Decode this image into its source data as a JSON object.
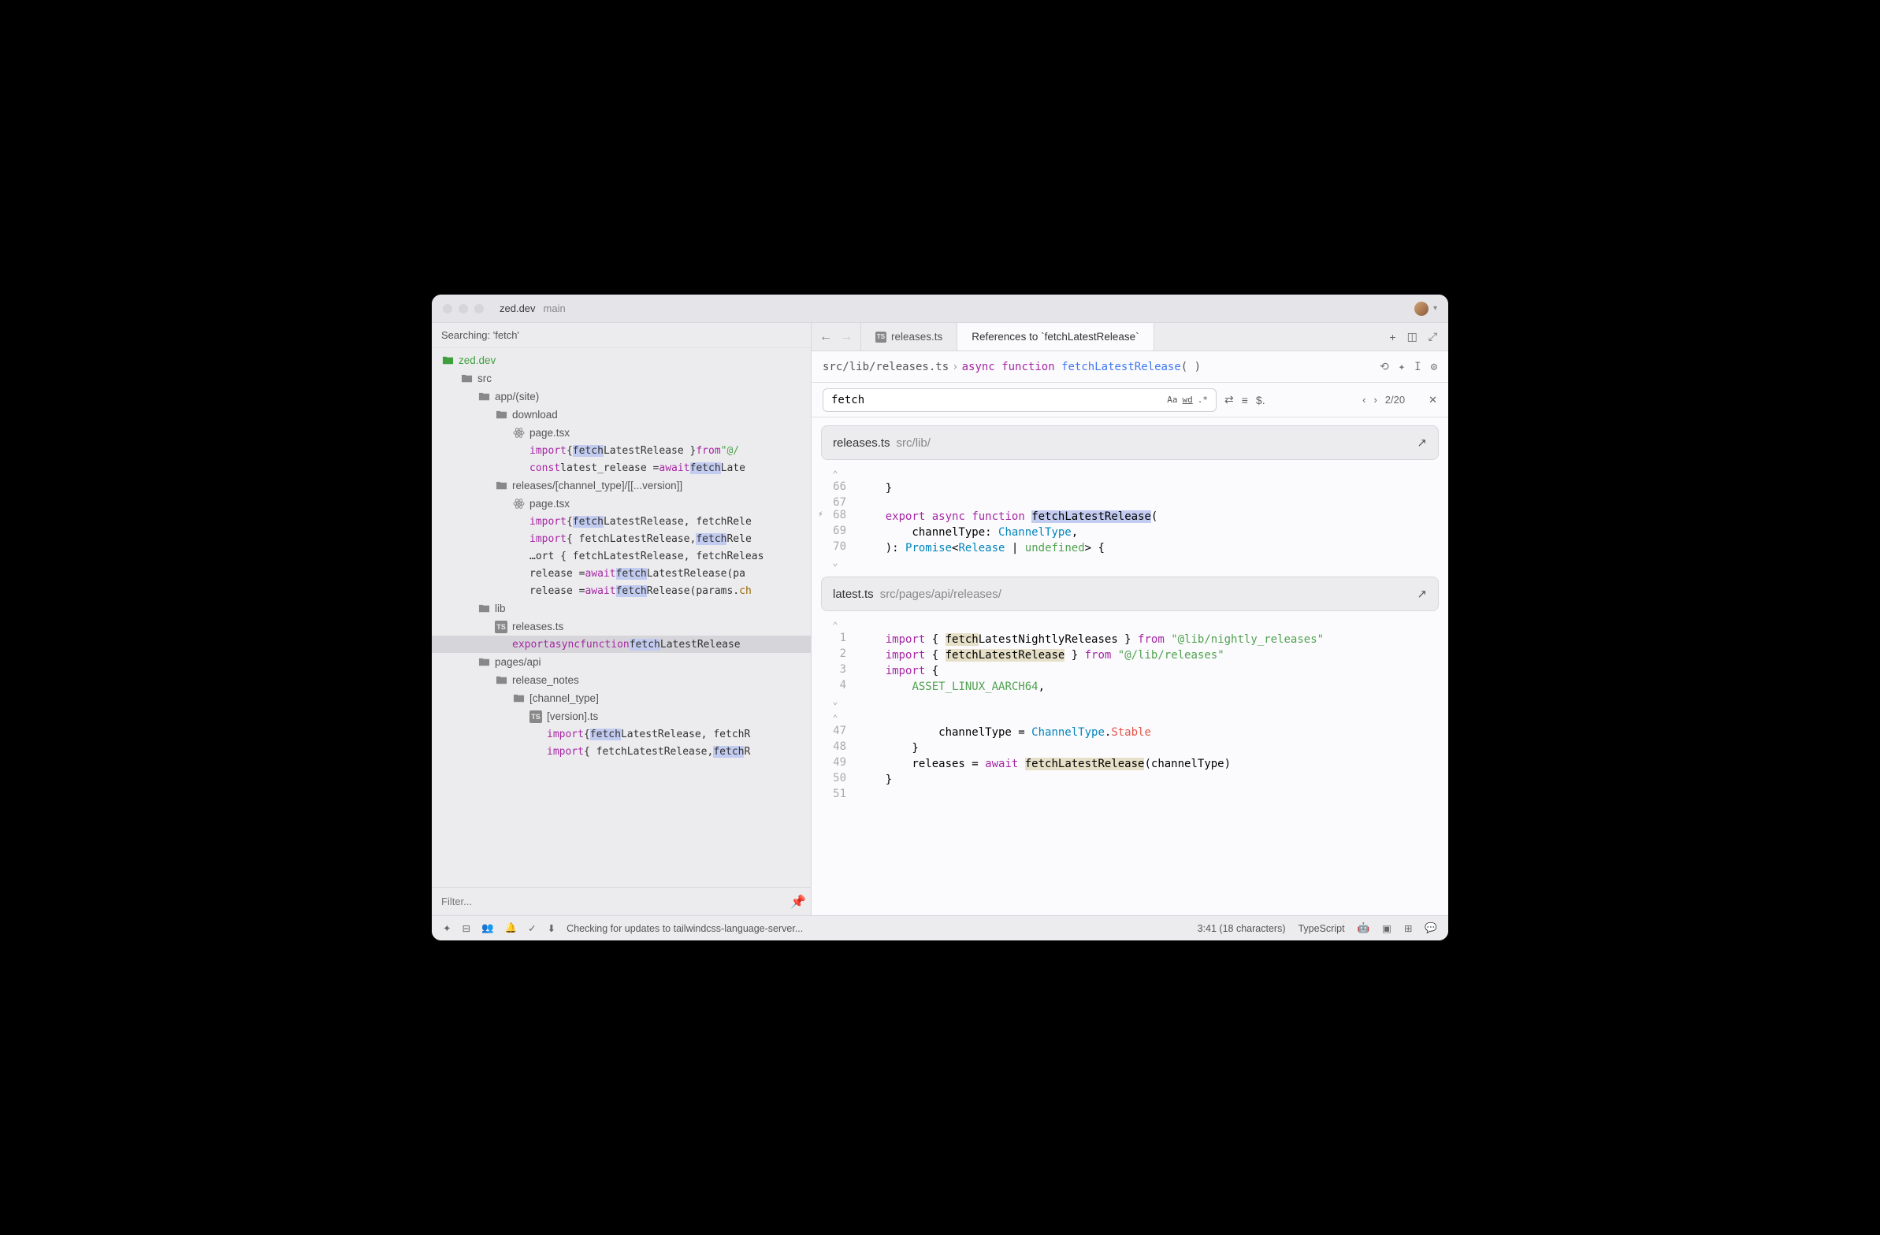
{
  "title": {
    "project": "zed.dev",
    "branch": "main"
  },
  "sidebar": {
    "search_label": "Searching: 'fetch'",
    "filter_placeholder": "Filter...",
    "tree": {
      "root": "zed.dev",
      "src": "src",
      "app_site": "app/(site)",
      "download": "download",
      "page_tsx_1": "page.tsx",
      "releases_channel": "releases/[channel_type]/[[...version]]",
      "page_tsx_2": "page.tsx",
      "lib": "lib",
      "releases_ts": "releases.ts",
      "pages_api": "pages/api",
      "release_notes": "release_notes",
      "channel_type": "[channel_type]",
      "version_ts": "[version].ts"
    },
    "snippets": {
      "s1_a": "import",
      "s1_b": " { ",
      "s1_c": "fetch",
      "s1_d": "LatestRelease } ",
      "s1_e": "from",
      "s1_f": " \"@/",
      "s2_a": "const",
      "s2_b": " latest_release = ",
      "s2_c": "await",
      "s2_d": " ",
      "s2_e": "fetch",
      "s2_f": "Late",
      "s3_a": "import",
      "s3_b": " { ",
      "s3_c": "fetch",
      "s3_d": "LatestRelease, fetchRele",
      "s4_a": "import",
      "s4_b": " { fetchLatestRelease, ",
      "s4_c": "fetch",
      "s4_d": "Rele",
      "s5_a": "…ort { fetchLatestRelease, fetchReleas",
      "s6_a": "release = ",
      "s6_b": "await",
      "s6_c": " ",
      "s6_d": "fetch",
      "s6_e": "LatestRelease(pa",
      "s7_a": "release = ",
      "s7_b": "await",
      "s7_c": " ",
      "s7_d": "fetch",
      "s7_e": "Release(params.",
      "s7_f": "ch",
      "s8_a": "export",
      "s8_b": " ",
      "s8_c": "async",
      "s8_d": " ",
      "s8_e": "function",
      "s8_f": " ",
      "s8_g": "fetch",
      "s8_h": "LatestRelease",
      "s9_a": "import",
      "s9_b": " { ",
      "s9_c": "fetch",
      "s9_d": "LatestRelease, fetchR",
      "s10_a": "import",
      "s10_b": " { fetchLatestRelease, ",
      "s10_c": "fetch",
      "s10_d": "R"
    }
  },
  "editor": {
    "tabs": {
      "releases": "releases.ts",
      "references": "References to `fetchLatestRelease`"
    },
    "breadcrumb": {
      "path": "src/lib/releases.ts",
      "kw_async": "async",
      "kw_function": "function",
      "fn": "fetchLatestRelease",
      "parens": "( )"
    },
    "search": {
      "value": "fetch",
      "case": "Aa",
      "word": "wd",
      "regex": ".*",
      "count": "2/20"
    },
    "result1": {
      "fname": "releases.ts",
      "fpath": "src/lib/"
    },
    "result2": {
      "fname": "latest.ts",
      "fpath": "src/pages/api/releases/"
    },
    "lines": {
      "l66_num": "66",
      "l66": "    }",
      "l67_num": "67",
      "l67": "",
      "l68_num": "68",
      "l68_a": "export",
      "l68_b": "async",
      "l68_c": "function",
      "l68_d": "fetchLatestRelease",
      "l68_e": "(",
      "l69_num": "69",
      "l69_a": "        channelType: ",
      "l69_b": "ChannelType",
      "l69_c": ",",
      "l70_num": "70",
      "l70_a": "    ): ",
      "l70_b": "Promise",
      "l70_c": "<",
      "l70_d": "Release",
      "l70_e": " | ",
      "l70_f": "undefined",
      "l70_g": "> {",
      "b1_num": "1",
      "b1_a": "import",
      "b1_b": " { ",
      "b1_c": "fetch",
      "b1_d": "LatestNightlyReleases } ",
      "b1_e": "from",
      "b1_f": " ",
      "b1_g": "\"@lib/nightly_releases\"",
      "b2_num": "2",
      "b2_a": "import",
      "b2_b": " { ",
      "b2_c": "fetchLatestRelease",
      "b2_d": " } ",
      "b2_e": "from",
      "b2_f": " ",
      "b2_g": "\"@/lib/releases\"",
      "b3_num": "3",
      "b3_a": "import",
      "b3_b": " {",
      "b4_num": "4",
      "b4_a": "        ",
      "b4_b": "ASSET_LINUX_AARCH64",
      "b4_c": ",",
      "c47_num": "47",
      "c47_a": "            channelType = ",
      "c47_b": "ChannelType",
      "c47_c": ".",
      "c47_d": "Stable",
      "c48_num": "48",
      "c48": "        }",
      "c49_num": "49",
      "c49_a": "        releases = ",
      "c49_b": "await",
      "c49_c": " ",
      "c49_d": "fetchLatestRelease",
      "c49_e": "(channelType)",
      "c50_num": "50",
      "c50": "    }",
      "c51_num": "51",
      "c51": ""
    }
  },
  "statusbar": {
    "message": "Checking for updates to tailwindcss-language-server...",
    "cursor": "3:41 (18 characters)",
    "lang": "TypeScript"
  }
}
